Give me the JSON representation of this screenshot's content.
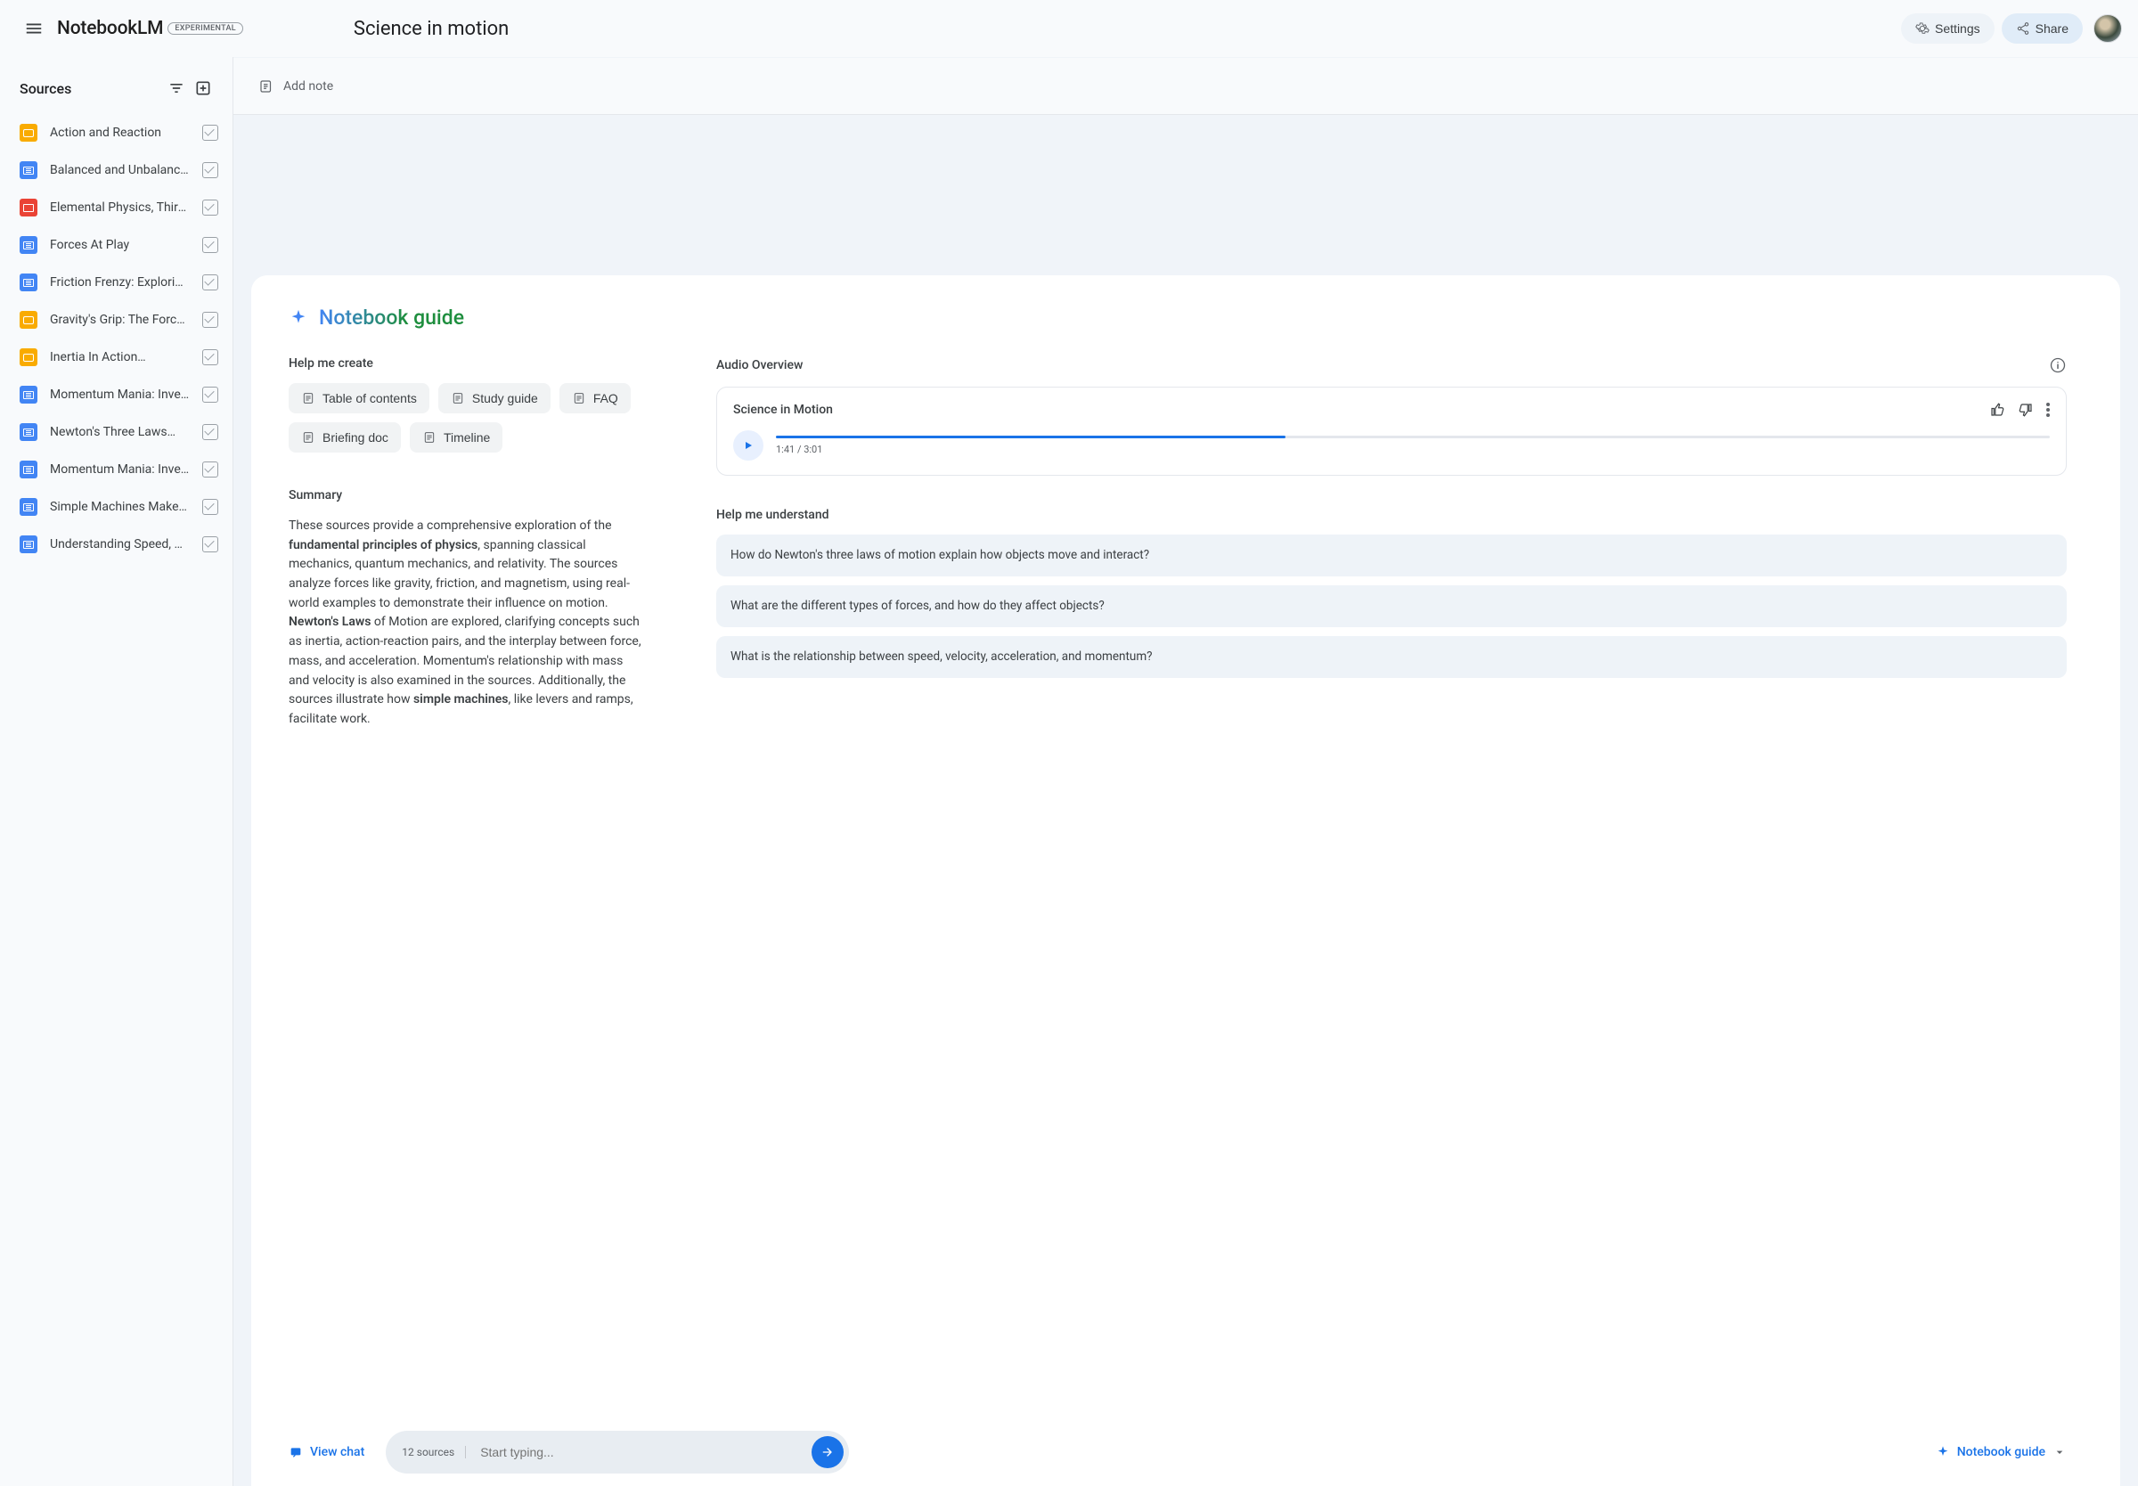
{
  "app": {
    "logo": "NotebookLM",
    "badge": "EXPERIMENTAL",
    "title": "Science in motion"
  },
  "topbar": {
    "settings": "Settings",
    "share": "Share"
  },
  "sidebar": {
    "title": "Sources",
    "items": [
      {
        "label": "Action and Reaction",
        "type": "slides"
      },
      {
        "label": "Balanced and Unbalance…",
        "type": "doc"
      },
      {
        "label": "Elemental Physics, Third…",
        "type": "pdf"
      },
      {
        "label": "Forces At Play",
        "type": "doc"
      },
      {
        "label": "Friction Frenzy: Explorin…",
        "type": "doc"
      },
      {
        "label": "Gravity's Grip: The Force…",
        "type": "slides"
      },
      {
        "label": "Inertia In Action…",
        "type": "slides"
      },
      {
        "label": "Momentum Mania: Inves…",
        "type": "doc"
      },
      {
        "label": "Newton's Three Laws…",
        "type": "doc"
      },
      {
        "label": "Momentum Mania: Inves…",
        "type": "doc"
      },
      {
        "label": "Simple Machines Make…",
        "type": "doc"
      },
      {
        "label": "Understanding Speed, Ve…",
        "type": "doc"
      }
    ]
  },
  "main": {
    "add_note": "Add note"
  },
  "guide": {
    "title": "Notebook guide",
    "help_create": "Help me create",
    "chips": {
      "toc": "Table of contents",
      "study": "Study guide",
      "faq": "FAQ",
      "briefing": "Briefing doc",
      "timeline": "Timeline"
    },
    "summary_title": "Summary",
    "summary": {
      "p1a": "These sources provide a comprehensive exploration of the ",
      "b1": "fundamental principles of physics",
      "p1b": ", spanning classical mechanics, quantum mechanics, and relativity. The sources analyze forces like gravity, friction, and magnetism, using real-world examples to demonstrate their influence on motion. ",
      "b2": "Newton's Laws",
      "p1c": " of Motion are explored, clarifying concepts such as inertia, action-reaction pairs, and the interplay between force, mass, and acceleration. Momentum's relationship with mass and velocity is also examined in the sources. Additionally, the sources illustrate how ",
      "b3": "simple machines",
      "p1d": ", like levers and ramps, facilitate work."
    },
    "audio_section": "Audio Overview",
    "audio": {
      "title": "Science in Motion",
      "time": "1:41 / 3:01",
      "progress_pct": 40
    },
    "help_understand": "Help me understand",
    "questions": [
      "How do Newton's three laws of motion explain how objects move and interact?",
      "What are the different types of forces, and how do they affect objects?",
      "What is the relationship between speed, velocity, acceleration, and momentum?"
    ]
  },
  "bottom": {
    "view_chat": "View chat",
    "source_count": "12 sources",
    "placeholder": "Start typing...",
    "nb_guide": "Notebook guide"
  }
}
